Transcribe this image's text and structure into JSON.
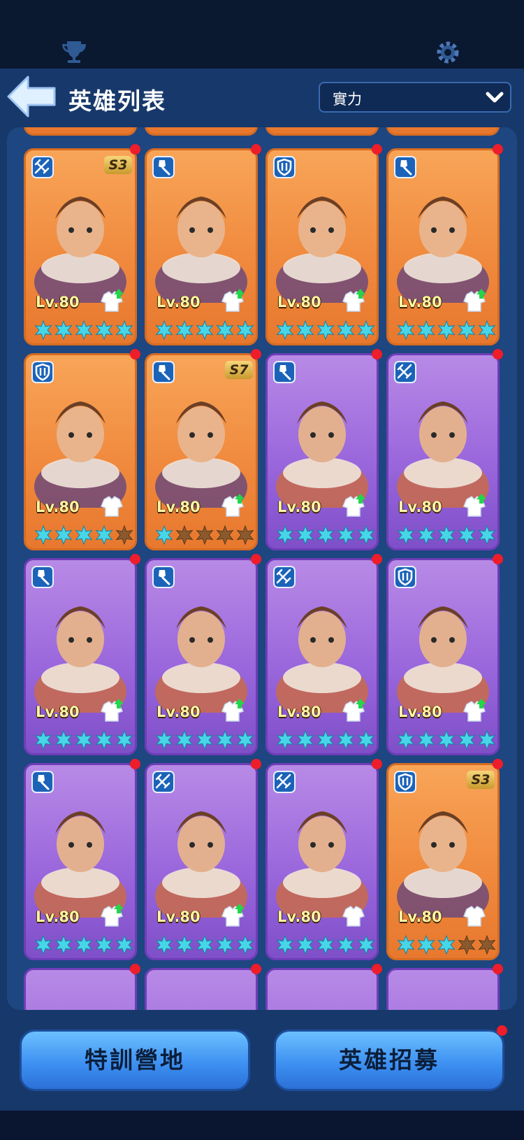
{
  "header": {
    "title": "英雄列表",
    "back_icon": "back-arrow-icon"
  },
  "sort": {
    "selected": "實力"
  },
  "buttons": {
    "training": "特訓營地",
    "recruit": "英雄招募"
  },
  "heroes": [
    {
      "level": "Lv.80",
      "class": "crossbow",
      "stars": 5,
      "rarity": "orange",
      "badge": "S3",
      "upgrade": true
    },
    {
      "level": "Lv.80",
      "class": "shovel",
      "stars": 5,
      "rarity": "orange",
      "badge": "",
      "upgrade": true
    },
    {
      "level": "Lv.80",
      "class": "shield",
      "stars": 5,
      "rarity": "orange",
      "badge": "",
      "upgrade": true
    },
    {
      "level": "Lv.80",
      "class": "shovel",
      "stars": 5,
      "rarity": "orange",
      "badge": "",
      "upgrade": true
    },
    {
      "level": "Lv.80",
      "class": "shield",
      "stars": 4,
      "rarity": "orange",
      "badge": "",
      "upgrade": false
    },
    {
      "level": "Lv.80",
      "class": "shovel",
      "stars": 1,
      "rarity": "orange",
      "badge": "S7",
      "upgrade": true
    },
    {
      "level": "Lv.80",
      "class": "shovel",
      "stars": 5,
      "rarity": "purple",
      "badge": "",
      "upgrade": true
    },
    {
      "level": "Lv.80",
      "class": "crossbow",
      "stars": 5,
      "rarity": "purple",
      "badge": "",
      "upgrade": true
    },
    {
      "level": "Lv.80",
      "class": "shovel",
      "stars": 5,
      "rarity": "purple",
      "badge": "",
      "upgrade": true
    },
    {
      "level": "Lv.80",
      "class": "shovel",
      "stars": 5,
      "rarity": "purple",
      "badge": "",
      "upgrade": true
    },
    {
      "level": "Lv.80",
      "class": "crossbow",
      "stars": 5,
      "rarity": "purple",
      "badge": "",
      "upgrade": true
    },
    {
      "level": "Lv.80",
      "class": "shield",
      "stars": 5,
      "rarity": "purple",
      "badge": "",
      "upgrade": true
    },
    {
      "level": "Lv.80",
      "class": "shovel",
      "stars": 5,
      "rarity": "purple",
      "badge": "",
      "upgrade": true
    },
    {
      "level": "Lv.80",
      "class": "crossbow",
      "stars": 5,
      "rarity": "purple",
      "badge": "",
      "upgrade": true
    },
    {
      "level": "Lv.80",
      "class": "crossbow",
      "stars": 5,
      "rarity": "purple",
      "badge": "",
      "upgrade": false
    },
    {
      "level": "Lv.80",
      "class": "shield",
      "stars": 3,
      "rarity": "orange",
      "badge": "S3",
      "upgrade": false
    }
  ],
  "colors": {
    "panel": "#17386b",
    "star": "#47d6e8",
    "orange_card": "#f08a3e",
    "purple_card": "#9a67dc",
    "red_dot": "#ee1d2a"
  }
}
